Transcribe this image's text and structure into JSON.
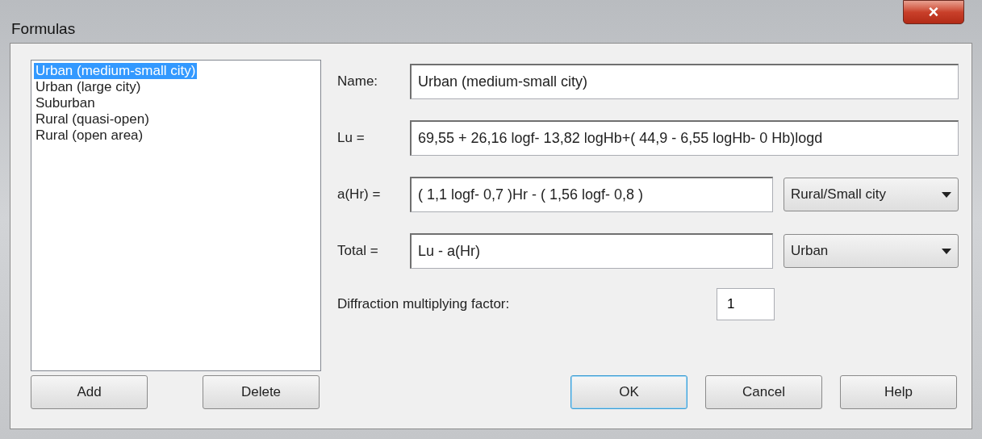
{
  "window": {
    "title": "Formulas",
    "close": "×"
  },
  "formula_list": [
    {
      "label": "Urban (medium-small city)",
      "selected": true
    },
    {
      "label": "Urban (large city)",
      "selected": false
    },
    {
      "label": "Suburban",
      "selected": false
    },
    {
      "label": "Rural (quasi-open)",
      "selected": false
    },
    {
      "label": "Rural (open area)",
      "selected": false
    }
  ],
  "name": {
    "label": "Name:",
    "value": "Urban (medium-small city)"
  },
  "lu": {
    "label": "Lu =",
    "value": "69,55 + 26,16 logf- 13,82 logHb+( 44,9 - 6,55 logHb- 0 Hb)logd"
  },
  "a_hr": {
    "label": "a(Hr) =",
    "value": "( 1,1 logf- 0,7 )Hr - ( 1,56 logf- 0,8 )",
    "dropdown": "Rural/Small city"
  },
  "total": {
    "label": "Total =",
    "value": "Lu - a(Hr)",
    "dropdown": "Urban"
  },
  "diffraction": {
    "label": "Diffraction multiplying factor:",
    "value": "1"
  },
  "list_buttons": [
    "Add",
    "Delete"
  ],
  "dialog_buttons": [
    {
      "label": "OK",
      "default": true
    },
    {
      "label": "Cancel",
      "default": false
    },
    {
      "label": "Help",
      "default": false
    }
  ]
}
